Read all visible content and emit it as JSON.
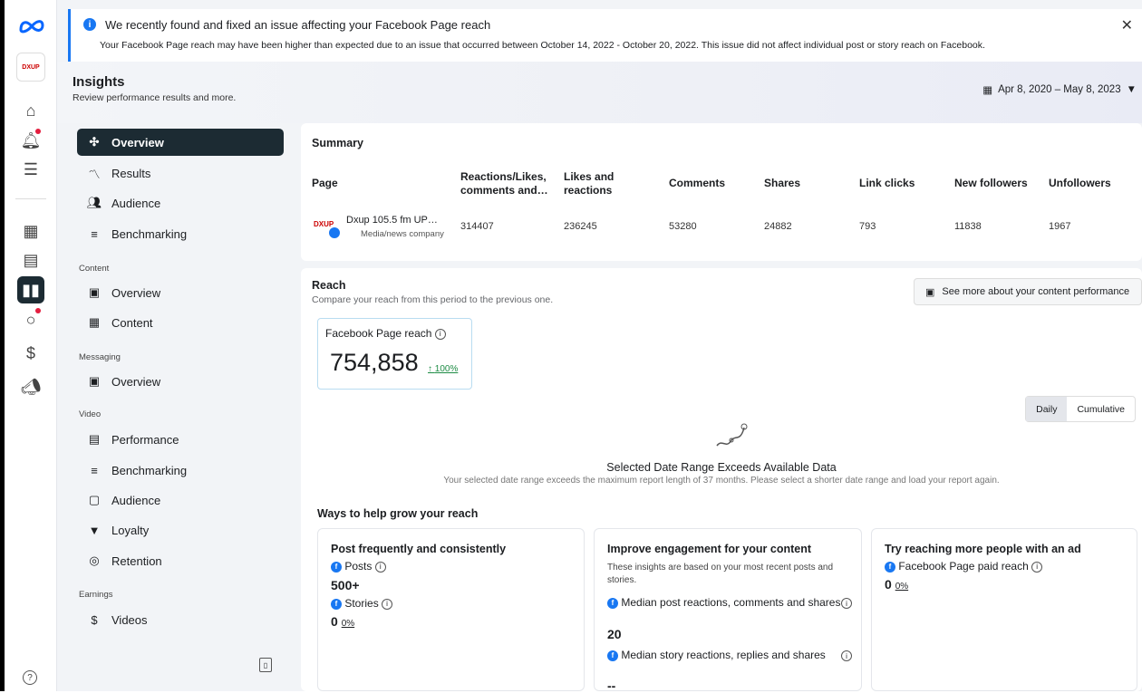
{
  "banner": {
    "title": "We recently found and fixed an issue affecting your Facebook Page reach",
    "subtitle": "Your Facebook Page reach may have been higher than expected due to an issue that occurred between October 14, 2022 - October 20, 2022. This issue did not affect individual post or story reach on Facebook."
  },
  "rail": {
    "logo_text": "DXUP"
  },
  "header": {
    "title": "Insights",
    "subtitle": "Review performance results and more.",
    "date_range": "Apr 8, 2020 – May 8, 2023"
  },
  "sidebar": {
    "items": [
      {
        "label": "Overview"
      },
      {
        "label": "Results"
      },
      {
        "label": "Audience"
      },
      {
        "label": "Benchmarking"
      },
      {
        "label": "Overview"
      },
      {
        "label": "Content"
      },
      {
        "label": "Overview"
      },
      {
        "label": "Performance"
      },
      {
        "label": "Benchmarking"
      },
      {
        "label": "Audience"
      },
      {
        "label": "Loyalty"
      },
      {
        "label": "Retention"
      },
      {
        "label": "Videos"
      }
    ],
    "sections": [
      "Content",
      "Messaging",
      "Video",
      "Earnings"
    ]
  },
  "summary": {
    "title": "Summary",
    "columns": [
      "Page",
      "Reactions/Likes, comments and…",
      "Likes and reactions",
      "Comments",
      "Shares",
      "Link clicks",
      "New followers",
      "Unfollowers"
    ],
    "page_name": "Dxup 105.5 fm UP…",
    "page_type": "Media/news company",
    "values": [
      "314407",
      "236245",
      "53280",
      "24882",
      "793",
      "11838",
      "1967"
    ]
  },
  "reach": {
    "title": "Reach",
    "subtitle": "Compare your reach from this period to the previous one.",
    "see_more": "See more about your content performance",
    "kpi_label": "Facebook Page reach",
    "kpi_value": "754,858",
    "kpi_change": "100%",
    "toggle": [
      "Daily",
      "Cumulative"
    ],
    "empty_title": "Selected Date Range Exceeds Available Data",
    "empty_sub": "Your selected date range exceeds the maximum report length of 37 months. Please select a shorter date range and load your report again.",
    "ways_title": "Ways to help grow your reach"
  },
  "tips": [
    {
      "title": "Post frequently and consistently",
      "posts_label": "Posts",
      "posts_value": "500+",
      "stories_label": "Stories",
      "stories_value": "0",
      "stories_pct": "0%"
    },
    {
      "title": "Improve engagement for your content",
      "note": "These insights are based on your most recent posts and stories.",
      "m1_label": "Median post reactions, comments and shares",
      "m1_value": "20",
      "m2_label": "Median story reactions, replies and shares",
      "m2_value": "--"
    },
    {
      "title": "Try reaching more people with an ad",
      "paid_label": "Facebook Page paid reach",
      "paid_value": "0",
      "paid_pct": "0%"
    }
  ],
  "colors": {
    "accent": "#1877f2",
    "active_nav": "#1c2b33",
    "positive": "#1e8c45"
  }
}
